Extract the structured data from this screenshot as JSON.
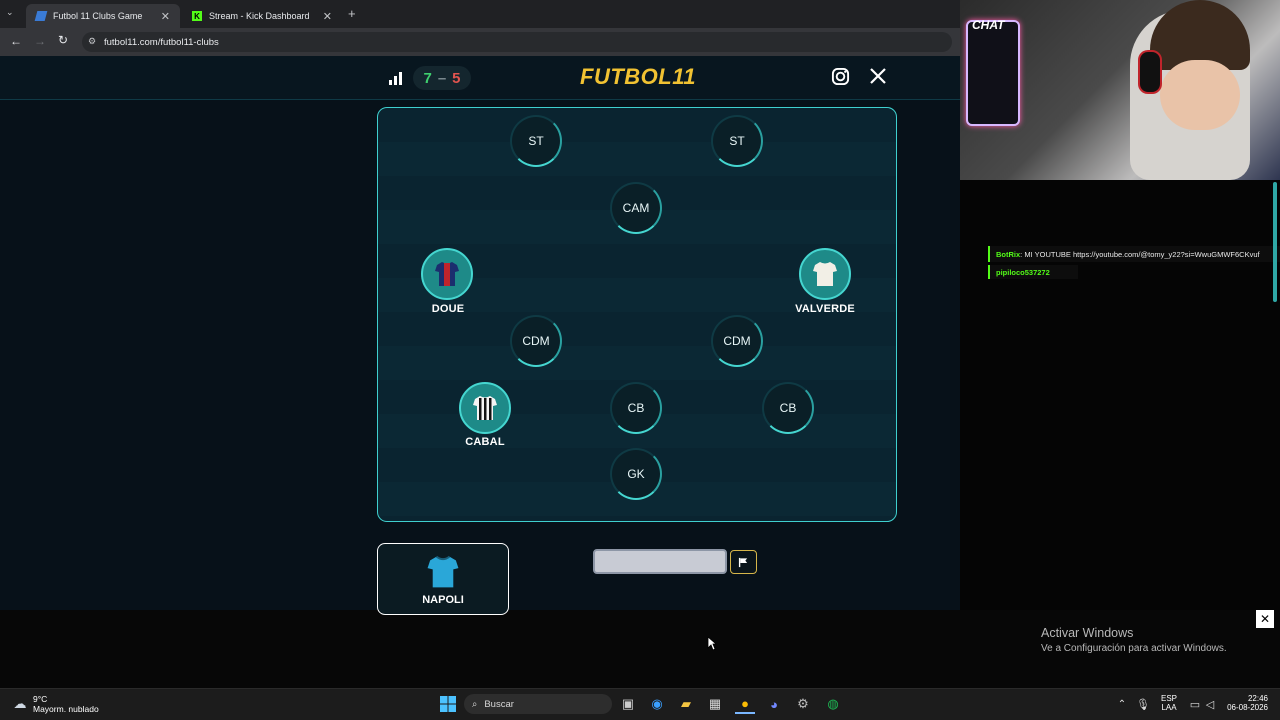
{
  "browser": {
    "tabs": [
      {
        "title": "Futbol 11 Clubs Game",
        "active": true
      },
      {
        "title": "Stream - Kick Dashboard",
        "active": false
      }
    ],
    "url": "futbol11.com/futbol11-clubs"
  },
  "header": {
    "logo": "FUTBOL11",
    "score_wins": "7",
    "score_sep": "–",
    "score_losses": "5"
  },
  "pitch": {
    "positions": {
      "st_left": "ST",
      "st_right": "ST",
      "cam": "CAM",
      "cdm_left": "CDM",
      "cdm_right": "CDM",
      "cb_center": "CB",
      "cb_right": "CB",
      "gk": "GK"
    },
    "players": {
      "doue": "DOUE",
      "valverde": "VALVERDE",
      "cabal": "CABAL"
    }
  },
  "club_card": {
    "name": "NAPOLI"
  },
  "guess_input": {
    "value": "",
    "placeholder": ""
  },
  "overlay": {
    "chat_label": "CHAT",
    "chat_lines": [
      {
        "user": "BotRix",
        "text": ": MI YOUTUBE https://youtube.com/@tomy_y22?si=WwuGMWF6CKvuf"
      },
      {
        "user": "pipiloco537272",
        "text": ""
      }
    ]
  },
  "windows_watermark": {
    "title": "Activar Windows",
    "subtitle": "Ve a Configuración para activar Windows."
  },
  "taskbar": {
    "weather_temp": "9°C",
    "weather_desc": "Mayorm. nublado",
    "search_label": "Buscar",
    "lang_top": "ESP",
    "lang_bottom": "LAA",
    "time": "22:46",
    "date": "06-08-2026"
  },
  "colors": {
    "accent": "#45d6d0",
    "logo_gold": "#f1c232",
    "win_green": "#3ecf6e",
    "loss_red": "#e0544f"
  }
}
